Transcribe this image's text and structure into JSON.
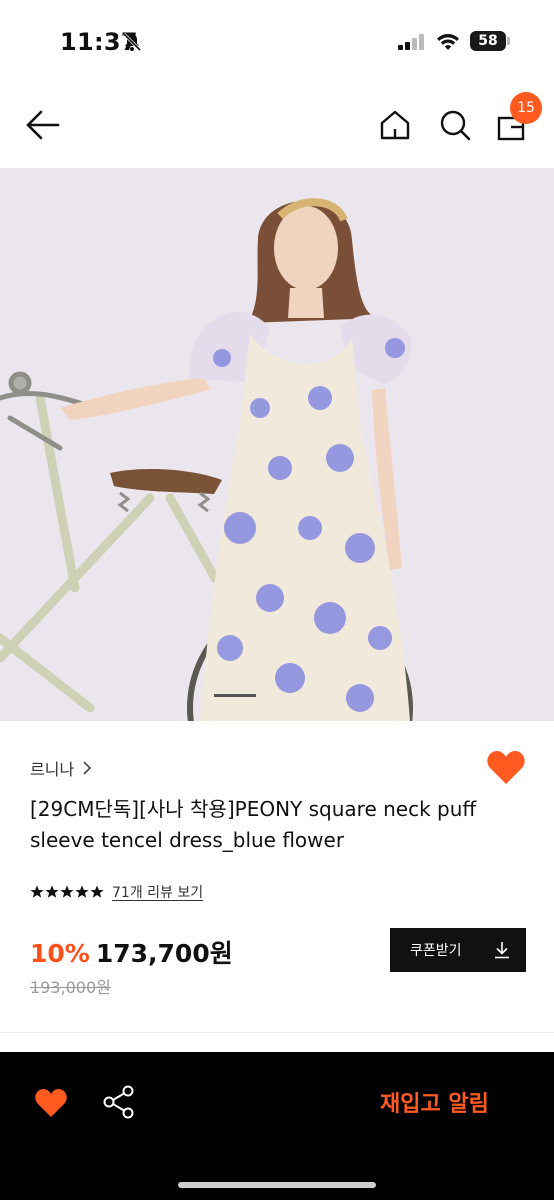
{
  "status_bar": {
    "time": "11:37",
    "battery": "58"
  },
  "nav": {
    "cart_count": "15"
  },
  "product": {
    "brand": "르니나",
    "title": "[29CM단독][사나 착용]PEONY square neck puff sleeve tencel dress_blue flower",
    "rating_stars": 5,
    "review_link": "71개 리뷰 보기",
    "discount": "10%",
    "sale_price": "173,700원",
    "original_price": "193,000원",
    "coupon_label": "쿠폰받기"
  },
  "bottom_bar": {
    "restock_label": "재입고 알림"
  },
  "colors": {
    "accent": "#ff5a1f",
    "dark": "#111111"
  },
  "icons": [
    "bell-off-icon",
    "signal-icon",
    "wifi-icon",
    "battery-icon",
    "back-arrow-icon",
    "home-icon",
    "search-icon",
    "bag-icon",
    "chevron-right-icon",
    "heart-icon",
    "star-icon",
    "download-icon",
    "share-icon"
  ]
}
